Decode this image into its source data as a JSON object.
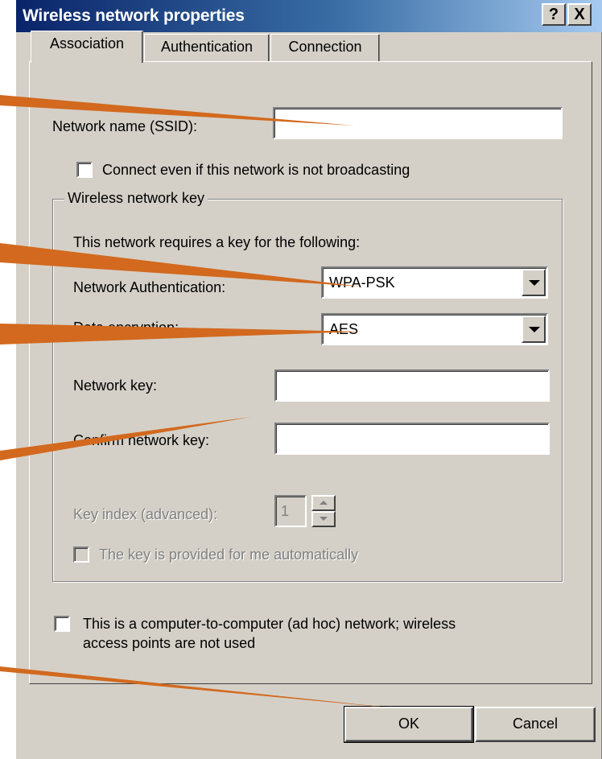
{
  "window": {
    "title": "Wireless network properties",
    "help_label": "?",
    "close_label": "X"
  },
  "tabs": [
    {
      "label": "Association",
      "active": true
    },
    {
      "label": "Authentication",
      "active": false
    },
    {
      "label": "Connection",
      "active": false
    }
  ],
  "association": {
    "network_name_label": "Network name (SSID):",
    "network_name_value": "",
    "connect_not_broadcasting_label": "Connect even if this network is not broadcasting",
    "connect_not_broadcasting_checked": false,
    "group_title": "Wireless network key",
    "requires_key_text": "This network requires a key for the following:",
    "network_auth_label": "Network Authentication:",
    "network_auth_value": "WPA-PSK",
    "data_encryption_label": "Data encryption:",
    "data_encryption_value": "AES",
    "network_key_label": "Network key:",
    "network_key_value": "",
    "confirm_key_label": "Confirm network key:",
    "confirm_key_value": "",
    "key_index_label": "Key index (advanced):",
    "key_index_value": "1",
    "key_provided_label": "The key is provided for me automatically",
    "key_provided_checked": false,
    "adhoc_label_line1": "This is a computer-to-computer (ad hoc) network; wireless",
    "adhoc_label_line2": "access points are not used",
    "adhoc_checked": false
  },
  "buttons": {
    "ok_label": "OK",
    "cancel_label": "Cancel"
  },
  "annotation_color": "#d2691e"
}
